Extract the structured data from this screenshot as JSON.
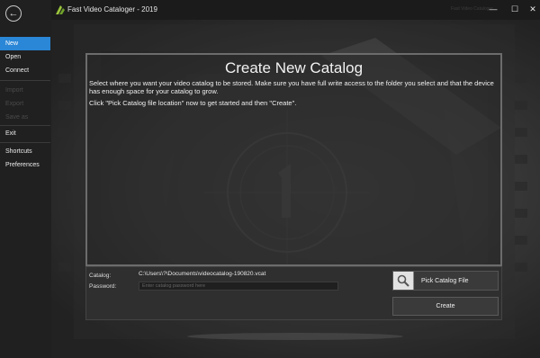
{
  "window": {
    "title": "Fast Video Cataloger - 2019",
    "title_faint": "Fast Video Cataloger",
    "minimize_glyph": "—",
    "maximize_glyph": "☐",
    "close_glyph": "✕"
  },
  "sidebar": {
    "back_glyph": "←",
    "items": [
      {
        "label": "New"
      },
      {
        "label": "Open"
      },
      {
        "label": "Connect"
      },
      {
        "label": "Import"
      },
      {
        "label": "Export"
      },
      {
        "label": "Save as"
      },
      {
        "label": "Exit"
      },
      {
        "label": "Shortcuts"
      },
      {
        "label": "Preferences"
      }
    ],
    "active_index": 0
  },
  "panel": {
    "title": "Create New Catalog",
    "description": "Select where you want your video catalog to be stored. Make sure you have full write access to the folder you select and that the device has enough space for your catalog to grow.",
    "hint": "Click \"Pick Catalog file location\" now to get started and then \"Create\"."
  },
  "form": {
    "catalog_label": "Catalog:",
    "catalog_path": "C:\\Users\\?\\Documents\\videocatalog-190820.vcat",
    "password_label": "Password:",
    "password_placeholder": "Enter catalog password here",
    "password_value": ""
  },
  "buttons": {
    "pick": "Pick Catalog File",
    "create": "Create"
  },
  "icons": {
    "back": "back-arrow-icon",
    "logo": "app-logo-icon",
    "pick": "magnifier-icon"
  },
  "colors": {
    "accent": "#2a86d6",
    "logo_green": "#9bc53d"
  }
}
